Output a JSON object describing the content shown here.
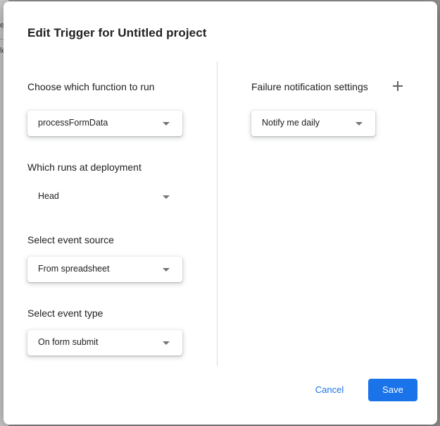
{
  "background": {
    "fragment_1": "e",
    "fragment_2": "le"
  },
  "dialog": {
    "title": "Edit Trigger for Untitled project"
  },
  "left": {
    "function": {
      "label": "Choose which function to run",
      "value": "processFormData"
    },
    "deployment": {
      "label": "Which runs at deployment",
      "value": "Head"
    },
    "event_source": {
      "label": "Select event source",
      "value": "From spreadsheet"
    },
    "event_type": {
      "label": "Select event type",
      "value": "On form submit"
    }
  },
  "right": {
    "failure": {
      "label": "Failure notification settings",
      "value": "Notify me daily"
    }
  },
  "footer": {
    "cancel_label": "Cancel",
    "save_label": "Save"
  },
  "colors": {
    "accent": "#1a73e8",
    "text": "#202124",
    "divider": "#dadce0"
  },
  "icons": {
    "add": "plus-icon",
    "dropdown": "caret-down-icon"
  }
}
